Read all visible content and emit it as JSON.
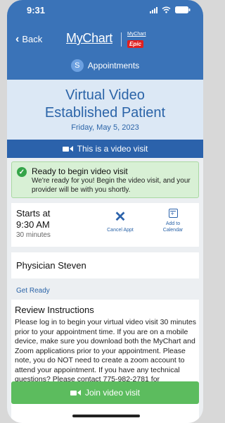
{
  "status_bar": {
    "time": "9:31"
  },
  "nav": {
    "back_label": "Back",
    "logo_text": "MyChart",
    "epic_small": "MyChart",
    "epic_badge": "Epic"
  },
  "section": {
    "badge_letter": "S",
    "label": "Appointments"
  },
  "visit": {
    "title_line1": "Virtual Video",
    "title_line2": "Established Patient",
    "date": "Friday, May 5, 2023"
  },
  "video_banner": "This is a video visit",
  "ready": {
    "title": "Ready to begin video visit",
    "message": "We're ready for you! Begin the video visit, and your provider will be with you shortly."
  },
  "appointment": {
    "starts_label": "Starts at",
    "start_time": "9:30 AM",
    "duration": "30 minutes",
    "cancel_label": "Cancel Appt",
    "calendar_label_1": "Add to",
    "calendar_label_2": "Calendar"
  },
  "physician": "Physician Steven",
  "get_ready_label": "Get Ready",
  "review": {
    "title": "Review Instructions",
    "body": "Please log in to begin your virtual video visit 30 minutes prior to your appointment time. If you are on a mobile device, make sure you download both the MyChart and Zoom applications prior to your appointment. Please note, you do NOT need to create a zoom account to attend your appointment. If you have any technical questions? Please contact 775-982-2781 for"
  },
  "join_button": "Join video visit",
  "colors": {
    "header_blue": "#3a73b8",
    "banner_blue": "#2b62ab",
    "success_green": "#5cbc5e"
  }
}
